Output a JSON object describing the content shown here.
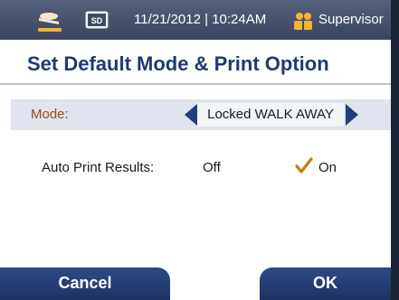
{
  "status_bar": {
    "device_icon": "instrument-icon",
    "sd_icon": "sd-card-icon",
    "sd_label": "SD",
    "datetime": "11/21/2012 | 10:24AM",
    "user_icon": "user-group-icon",
    "user": "Supervisor"
  },
  "page": {
    "title": "Set Default Mode & Print Option"
  },
  "mode": {
    "label": "Mode:",
    "value": "Locked WALK AWAY",
    "prev_icon": "arrow-left-icon",
    "next_icon": "arrow-right-icon"
  },
  "auto_print": {
    "label": "Auto Print Results:",
    "off_label": "Off",
    "on_label": "On",
    "selected": "On",
    "check_icon": "checkmark-icon"
  },
  "buttons": {
    "cancel": "Cancel",
    "ok": "OK"
  },
  "colors": {
    "status_bar": "#3f4a66",
    "title_text": "#1f3a73",
    "mode_row_bg": "#dfe4ef",
    "mode_label": "#9c4d10",
    "arrow": "#233f78",
    "button_bg": "#24396e",
    "check": "#c87a10"
  }
}
